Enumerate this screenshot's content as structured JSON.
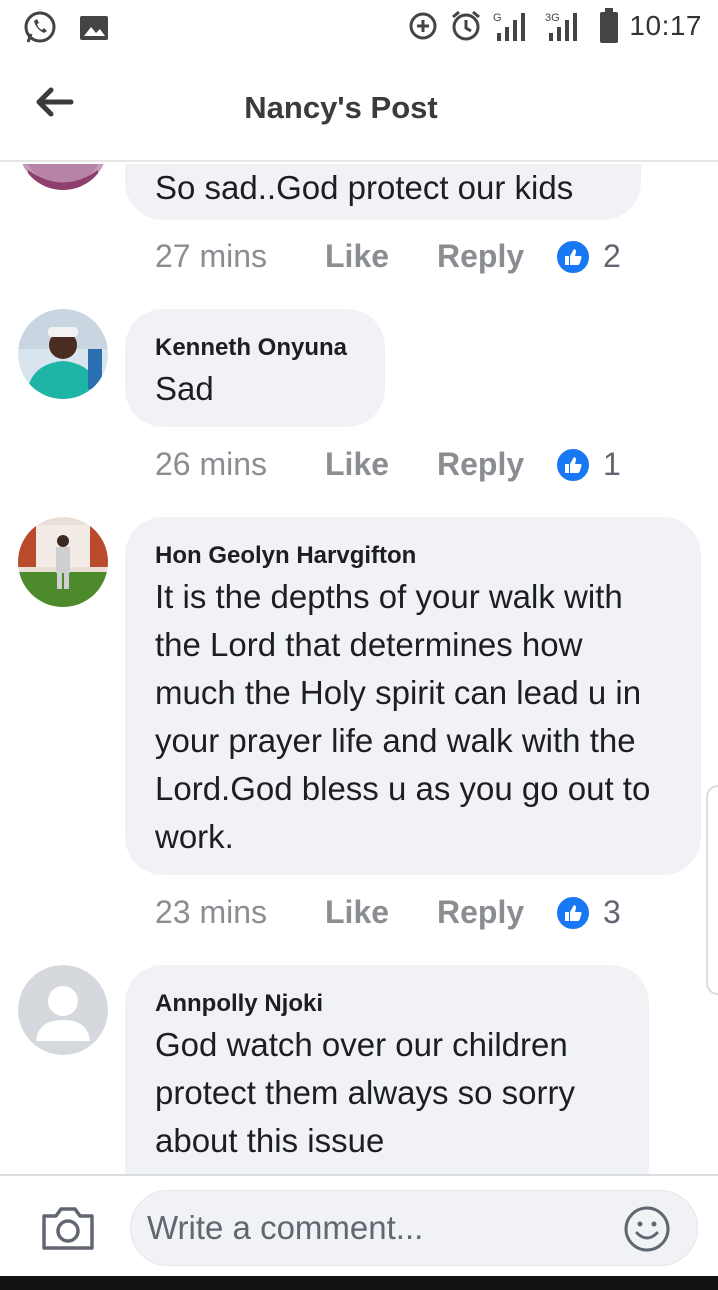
{
  "status_bar": {
    "time": "10:17",
    "network_label": "3G",
    "icons": [
      "whatsapp-icon",
      "gallery-icon",
      "data-saver-icon",
      "alarm-icon",
      "signal-icon",
      "signal-3g-icon",
      "battery-icon"
    ]
  },
  "header": {
    "title": "Nancy's Post",
    "back_icon": "arrow-left-icon"
  },
  "comments": [
    {
      "author": "",
      "text": "So sad..God protect our kids",
      "time": "27 mins",
      "like_label": "Like",
      "reply_label": "Reply",
      "reaction_count": "2"
    },
    {
      "author": "Kenneth Onyuna",
      "text": "Sad",
      "time": "26 mins",
      "like_label": "Like",
      "reply_label": "Reply",
      "reaction_count": "1"
    },
    {
      "author": "Hon Geolyn Harvgifton",
      "text": "It is the depths of your walk with the Lord that determines how much the Holy spirit can lead u in your prayer life and walk with the Lord.God bless u as you go out to work.",
      "time": "23 mins",
      "like_label": "Like",
      "reply_label": "Reply",
      "reaction_count": "3"
    },
    {
      "author": "Annpolly Njoki",
      "text": "God watch over our children protect them always so sorry about this issue"
    }
  ],
  "composer": {
    "placeholder": "Write a comment...",
    "camera_icon": "camera-icon",
    "emoji_icon": "emoji-icon"
  },
  "colors": {
    "bubble": "#f0f2f5",
    "meta_text": "#8a8d91",
    "like_blue": "#1877f2",
    "title": "#3a3b3c"
  }
}
